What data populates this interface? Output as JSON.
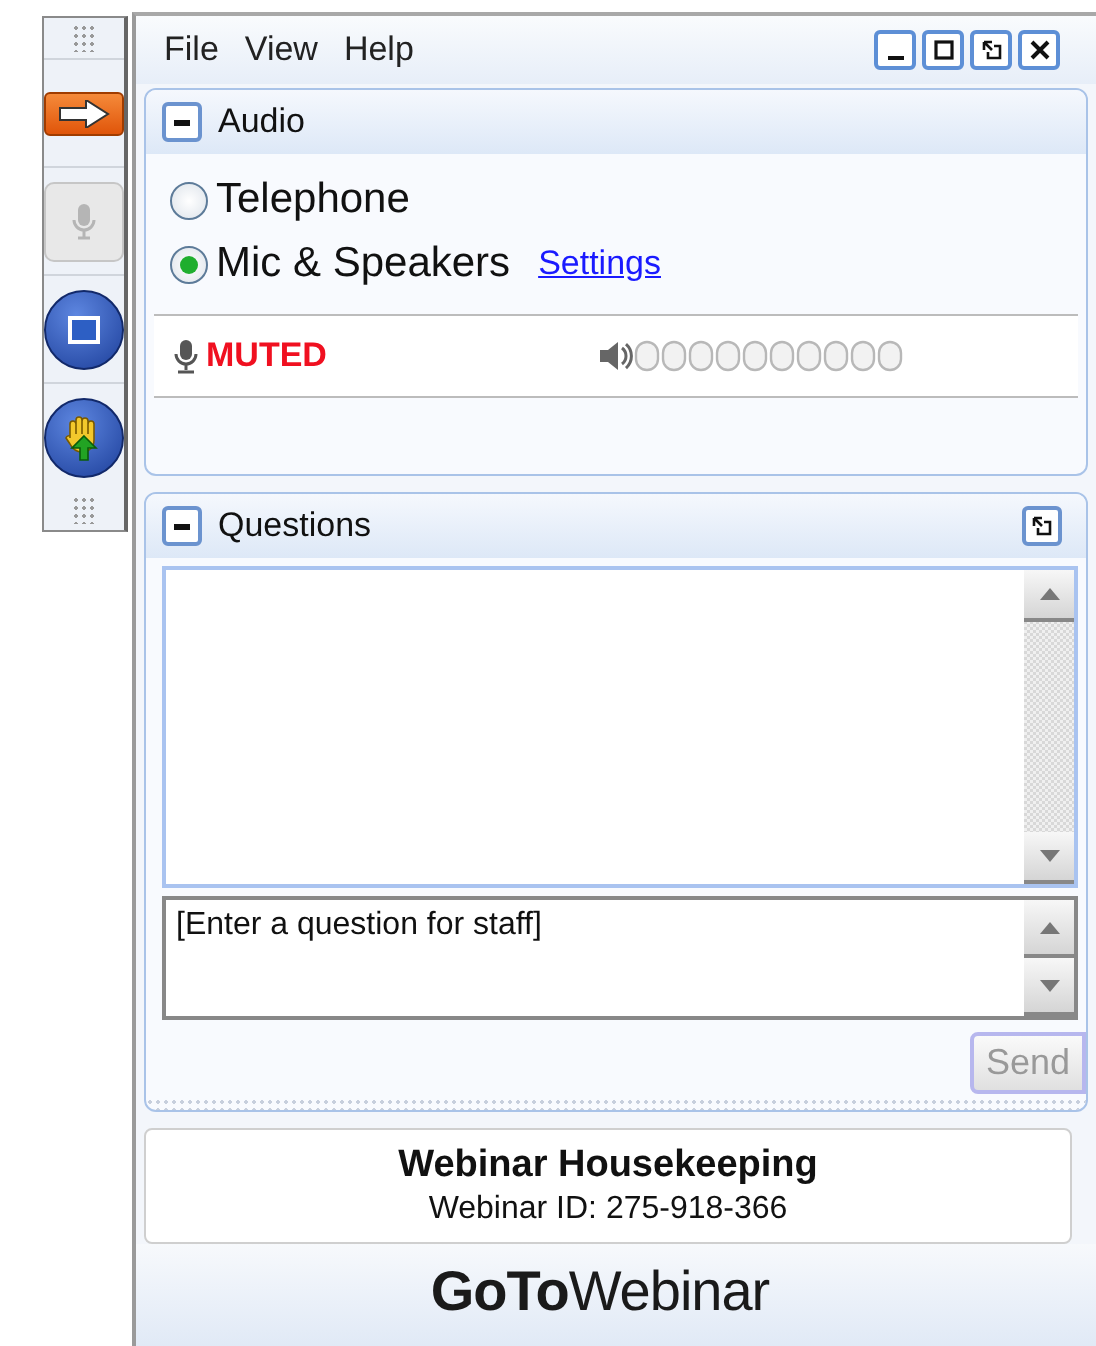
{
  "toolbar": {
    "buttons": [
      {
        "kind": "arrow",
        "disabled": false
      },
      {
        "kind": "mic",
        "disabled": true
      },
      {
        "kind": "screen",
        "disabled": false
      },
      {
        "kind": "hand",
        "disabled": false
      }
    ]
  },
  "menu": [
    "File",
    "View",
    "Help"
  ],
  "audio": {
    "title": "Audio",
    "options": [
      {
        "label": "Telephone",
        "selected": false
      },
      {
        "label": "Mic & Speakers",
        "selected": true
      }
    ],
    "settings_link": "Settings",
    "mic_status": "MUTED"
  },
  "questions": {
    "title": "Questions",
    "placeholder": "[Enter a question for staff]",
    "send": "Send"
  },
  "info": {
    "title": "Webinar Housekeeping",
    "id": "Webinar ID: 275-918-366"
  },
  "logo": "**GoTo**Webinar"
}
